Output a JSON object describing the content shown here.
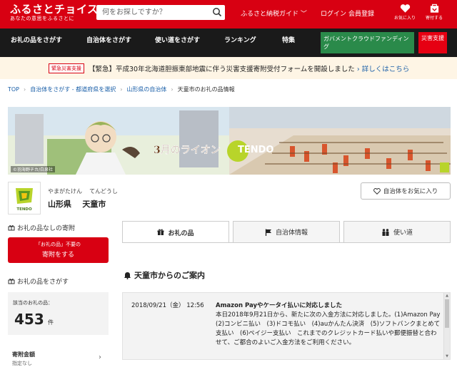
{
  "header": {
    "logo_main": "ふるさとチョイス",
    "logo_sub": "あなたの意思をふるさとに",
    "search_placeholder": "何をお探しですか？",
    "guide": "ふるさと納税ガイド",
    "login": "ログイン",
    "register": "会員登録",
    "favorites": "お気に入り",
    "cart": "寄付する",
    "bg_color": "#d80012"
  },
  "nav": {
    "items": [
      "お礼の品をさがす",
      "自治体をさがす",
      "使い道をさがす",
      "ランキング",
      "特集"
    ],
    "crowdfunding": "ガバメントクラウドファンディング",
    "disaster": "災害支援"
  },
  "emergency": {
    "badge": "緊急災害支援",
    "text": "【緊急】平成30年北海道胆振東部地震に伴う災害支援寄附受付フォームを開設しました",
    "link": "詳しくはこちら"
  },
  "breadcrumb": [
    "TOP",
    "自治体をさがす - 都道府県を選択",
    "山形県の自治体",
    "天童市のお礼の品情報"
  ],
  "banner": {
    "title": "3月のライオン",
    "tendo": "TENDO",
    "copyright": "©羽海野チカ/白泉社"
  },
  "municipality": {
    "logo_text": "TENDO",
    "kana_pref": "やまがたけん",
    "kana_city": "てんどうし",
    "pref": "山形県",
    "city": "天童市",
    "favorite_button": "自治体をお気に入り"
  },
  "sidebar": {
    "no_gift_heading": "お礼の品なしの寄附",
    "no_gift_btn_line1": "「お礼の品」不要の",
    "no_gift_btn_line2": "寄附をする",
    "search_heading": "お礼の品をさがす",
    "count_label": "該当のお礼の品：",
    "count": "453",
    "count_unit": "件",
    "sort_label": "寄附金額",
    "sort_value": "指定なし"
  },
  "tabs": [
    "お礼の品",
    "自治体情報",
    "使い道"
  ],
  "notice": {
    "heading": "天童市からのご案内",
    "date": "2018/09/21（金） 12:56",
    "title": "Amazon Payやケータイ払いに対応しました",
    "body": "本日2018年9月21日から、新たに次の入金方法に対応しました。(1)Amazon Pay　(2)コンビニ払い　(3)ドコモ払い　(4)auかんたん決済　(5)ソフトバンクまとめて支払い　(6)ペイジー支払い　これまでのクレジットカード払いや郵便振替と合わせて、ご都合のよいご入金方法をご利用ください。"
  }
}
